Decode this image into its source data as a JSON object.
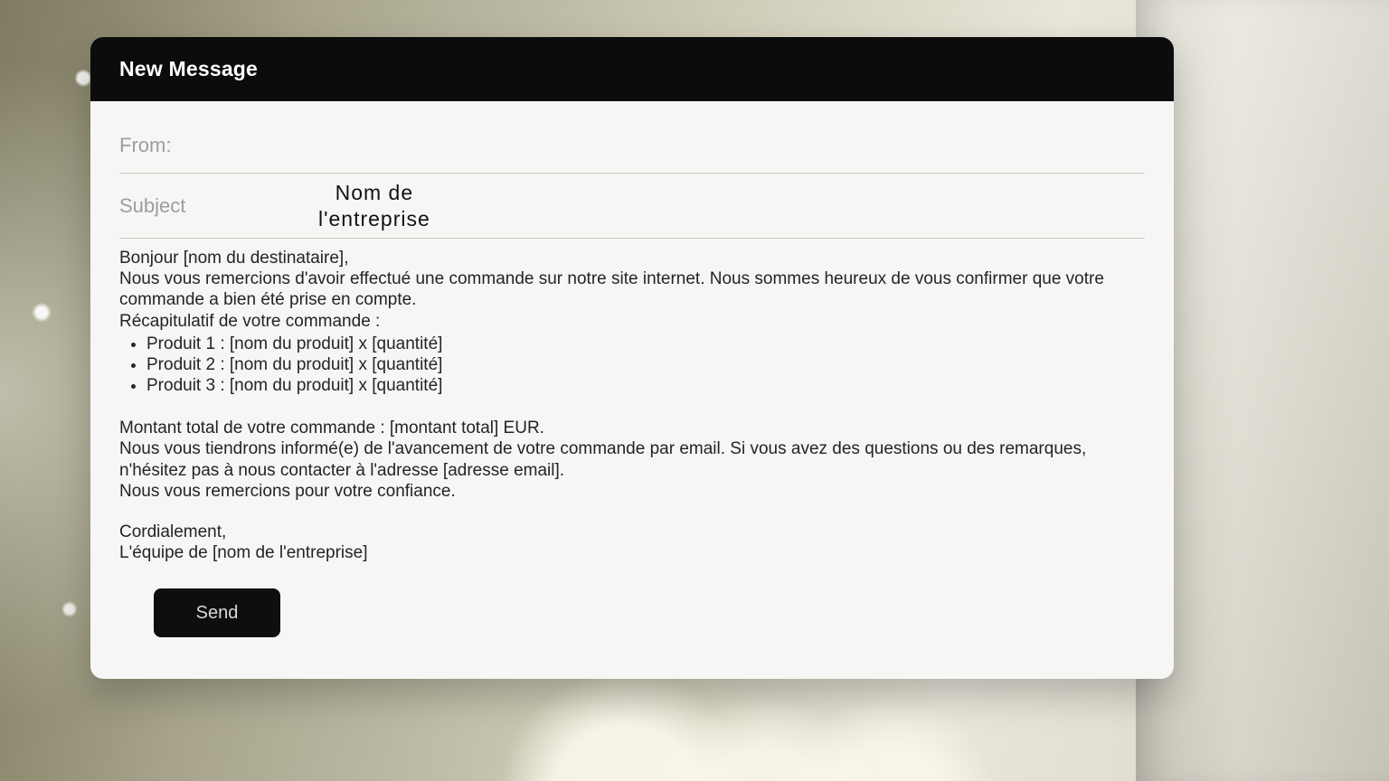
{
  "window": {
    "title": "New Message"
  },
  "fields": {
    "from_label": "From:",
    "from_value": "",
    "subject_label": "Subject",
    "subject_value": "Nom de\nl'entreprise"
  },
  "body": {
    "greeting": "Bonjour [nom du destinataire],",
    "intro": "Nous vous remercions d'avoir effectué une commande sur notre site internet. Nous sommes heureux de vous confirmer que votre commande a bien été prise en compte.",
    "recap_title": "Récapitulatif de votre commande :",
    "items": [
      "Produit 1 : [nom du produit] x [quantité]",
      "Produit 2 : [nom du produit] x [quantité]",
      "Produit 3 : [nom du produit] x [quantité]"
    ],
    "total": "Montant total de votre commande : [montant total] EUR.",
    "followup": "Nous vous tiendrons informé(e) de l'avancement de votre commande par email. Si vous avez des questions ou des remarques, n'hésitez pas à nous contacter à l'adresse [adresse email].",
    "thanks": "Nous vous remercions pour votre confiance.",
    "signoff": "Cordialement,",
    "signature": "L'équipe de [nom de l'entreprise]"
  },
  "actions": {
    "send_label": "Send"
  }
}
